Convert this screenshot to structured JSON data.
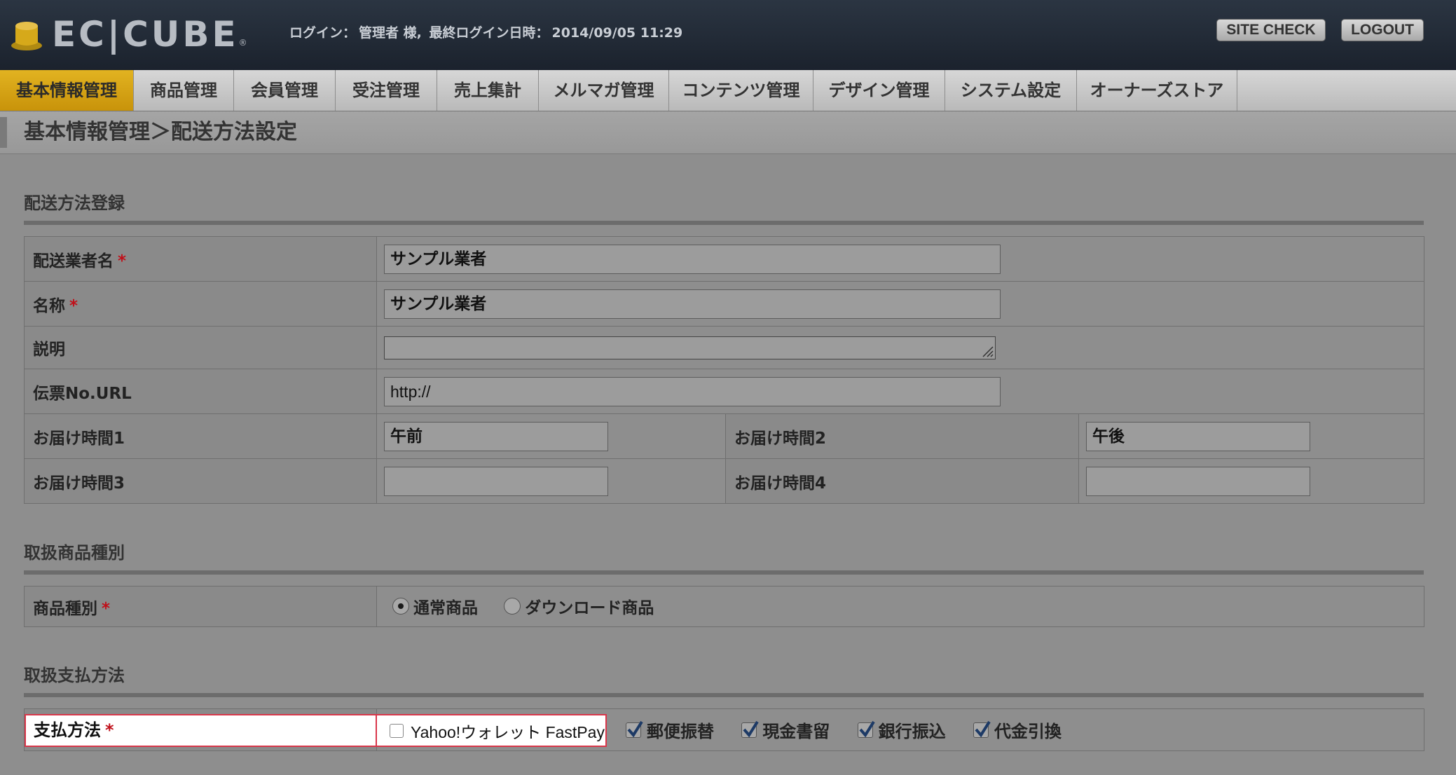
{
  "header": {
    "logo_text": "EC|CUBE",
    "logo_reg": "®",
    "login_label": "ログイン：",
    "user": "管理者 様,",
    "last_login_label": "最終ログイン日時：",
    "last_login": "2014/09/05 11:29",
    "site_check": "SITE CHECK",
    "logout": "LOGOUT"
  },
  "nav": [
    {
      "label": "基本情報管理",
      "active": true
    },
    {
      "label": "商品管理"
    },
    {
      "label": "会員管理"
    },
    {
      "label": "受注管理"
    },
    {
      "label": "売上集計"
    },
    {
      "label": "メルマガ管理"
    },
    {
      "label": "コンテンツ管理"
    },
    {
      "label": "デザイン管理"
    },
    {
      "label": "システム設定"
    },
    {
      "label": "オーナーズストア"
    }
  ],
  "page_title": "基本情報管理＞配送方法設定",
  "sections": {
    "delivery": {
      "heading": "配送方法登録",
      "carrier_label": "配送業者名",
      "carrier_value": "サンプル業者",
      "name_label": "名称",
      "name_value": "サンプル業者",
      "desc_label": "説明",
      "desc_value": "",
      "url_label": "伝票No.URL",
      "url_value": "http://",
      "time1_label": "お届け時間1",
      "time1_value": "午前",
      "time2_label": "お届け時間2",
      "time2_value": "午後",
      "time3_label": "お届け時間3",
      "time3_value": "",
      "time4_label": "お届け時間4",
      "time4_value": ""
    },
    "product_type": {
      "heading": "取扱商品種別",
      "label": "商品種別",
      "options": [
        {
          "label": "通常商品",
          "checked": true
        },
        {
          "label": "ダウンロード商品",
          "checked": false
        }
      ]
    },
    "payment": {
      "heading": "取扱支払方法",
      "label": "支払方法",
      "yahoo_label": "Yahoo!ウォレット FastPay",
      "yahoo_checked": false,
      "options": [
        {
          "label": "郵便振替",
          "checked": true
        },
        {
          "label": "現金書留",
          "checked": true
        },
        {
          "label": "銀行振込",
          "checked": true
        },
        {
          "label": "代金引換",
          "checked": true
        }
      ]
    }
  },
  "required_mark": "*",
  "colors": {
    "active_tab": "#d4a216",
    "required": "#c0101a",
    "highlight_border": "#d9364a"
  }
}
